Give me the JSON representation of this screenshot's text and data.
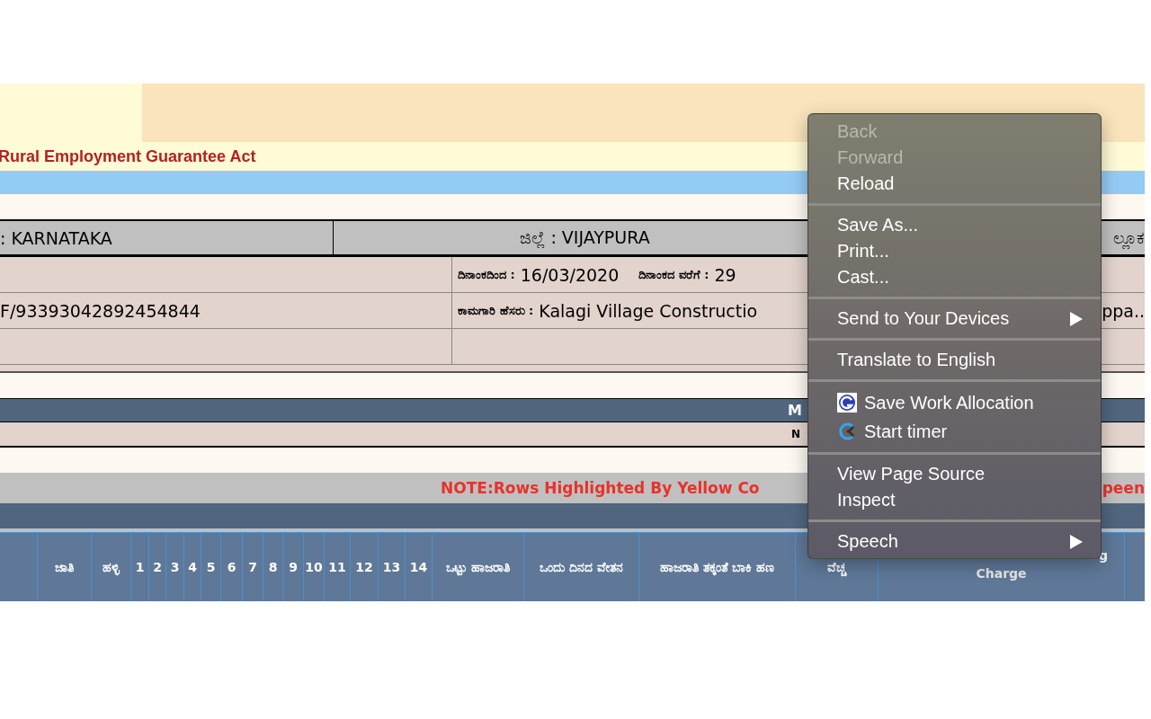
{
  "banner": {
    "title": "Rural Employment Guarantee Act"
  },
  "details": {
    "state": ": KARNATAKA",
    "district": "ಜಿಲ್ಲೆ : VIJAYPURA",
    "column_3": "ಲ್ಲೂಕ",
    "date_from_label": "ದಿನಾಂಕದಿಂದ :",
    "date_from": "16/03/2020",
    "date_to_label": "ದಿನಾಂಕದ ವರೆಗೆ :",
    "date_to": "29",
    "work_code": "F/93393042892454844",
    "work_name_label": "ಕಾಮಗಾರಿ ಹೆಸರು  :",
    "work_name": "Kalagi Village Constructio",
    "column_4": "ppa.."
  },
  "section_bar": {
    "text": "M"
  },
  "section_row": {
    "text": "N"
  },
  "note": {
    "text": "NOTE:Rows Highlighted By Yellow Co",
    "text_end": "peen"
  },
  "table": {
    "columns": [
      {},
      {
        "label": "ಜಾತಿ"
      },
      {
        "label": "ಹಳ್ಳಿ"
      },
      {
        "label": "1"
      },
      {
        "label": "2"
      },
      {
        "label": "3"
      },
      {
        "label": "4"
      },
      {
        "label": "5"
      },
      {
        "label": "6"
      },
      {
        "label": "7"
      },
      {
        "label": "8"
      },
      {
        "label": "9"
      },
      {
        "label": "10"
      },
      {
        "label": "11"
      },
      {
        "label": "12"
      },
      {
        "label": "13"
      },
      {
        "label": "14"
      },
      {
        "label": "ಒಟ್ಟು ಹಾಜರಾತಿ"
      },
      {
        "label": "ಒಂದು ದಿನದ ವೇತನ"
      },
      {
        "label": "ಹಾಜರಾತಿ ತಕ್ಕಂತೆ ಬಾಕಿ ಹಣ"
      },
      {
        "label": "ವೆಚ್ಚ"
      },
      {
        "label": "Charge",
        "label_top": "g"
      },
      {}
    ]
  },
  "context_menu": {
    "groups": [
      [
        {
          "label": "Back",
          "disabled": true,
          "submenu": false,
          "kind": "plain"
        },
        {
          "label": "Forward",
          "disabled": true,
          "submenu": false,
          "kind": "plain"
        },
        {
          "label": "Reload",
          "disabled": false,
          "submenu": false,
          "kind": "plain"
        }
      ],
      [
        {
          "label": "Save As...",
          "disabled": false,
          "submenu": false,
          "kind": "plain"
        },
        {
          "label": "Print...",
          "disabled": false,
          "submenu": false,
          "kind": "plain"
        },
        {
          "label": "Cast...",
          "disabled": false,
          "submenu": false,
          "kind": "plain"
        }
      ],
      [
        {
          "label": "Send to Your Devices",
          "disabled": false,
          "submenu": true,
          "kind": "plain"
        }
      ],
      [
        {
          "label": "Translate to English",
          "disabled": false,
          "submenu": false,
          "kind": "plain"
        }
      ],
      [
        {
          "label": "Save Work Allocation",
          "disabled": false,
          "submenu": false,
          "kind": "extension"
        },
        {
          "label": "Start timer",
          "disabled": false,
          "submenu": false,
          "kind": "extension"
        }
      ],
      [
        {
          "label": "View Page Source",
          "disabled": false,
          "submenu": false,
          "kind": "plain"
        },
        {
          "label": "Inspect",
          "disabled": false,
          "submenu": false,
          "kind": "plain"
        }
      ],
      [
        {
          "label": "Speech",
          "disabled": false,
          "submenu": true,
          "kind": "plain"
        }
      ]
    ]
  }
}
